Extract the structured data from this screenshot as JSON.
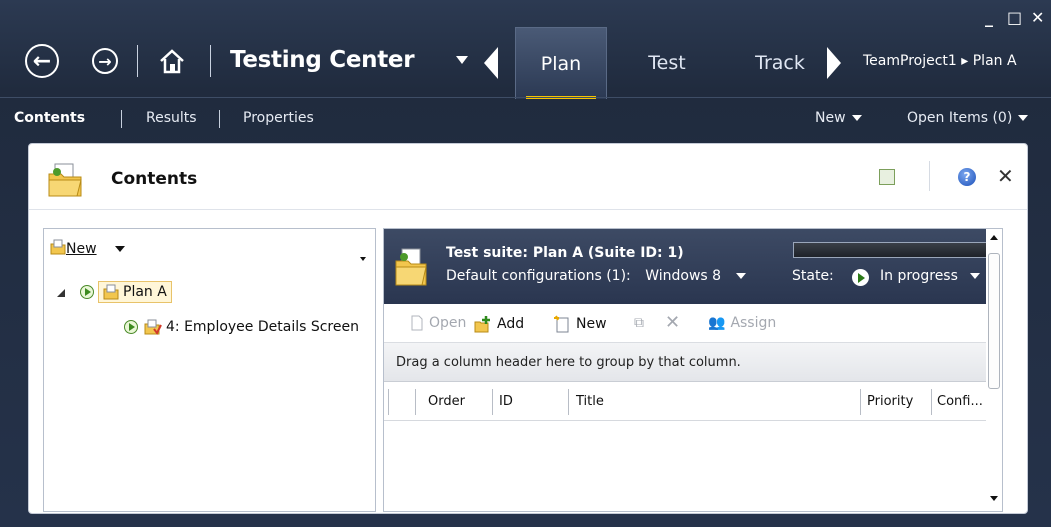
{
  "title_bar": {
    "app_title": "Testing Center",
    "tabs": [
      {
        "label": "Plan",
        "active": true
      },
      {
        "label": "Test",
        "active": false
      },
      {
        "label": "Track",
        "active": false
      }
    ],
    "breadcrumb": "TeamProject1 ▸ Plan A",
    "window_controls": {
      "minimize": "_",
      "maximize": "□",
      "close": "✕"
    }
  },
  "subnav": {
    "items": [
      {
        "label": "Contents",
        "active": true
      },
      {
        "label": "Results",
        "active": false
      },
      {
        "label": "Properties",
        "active": false
      }
    ],
    "new_label": "New",
    "open_items_label": "Open Items (0)"
  },
  "panel": {
    "title": "Contents",
    "icons": [
      "refresh-icon",
      "help-icon",
      "close-icon"
    ]
  },
  "tree": {
    "new_label": "New",
    "nodes": [
      {
        "label": "Plan A",
        "icon": "folder-icon",
        "selected": true
      },
      {
        "label": "4: Employee Details Screen",
        "icon": "requirement-suite-icon",
        "selected": false
      }
    ]
  },
  "suite": {
    "title": "Test suite:  Plan A (Suite ID: 1)",
    "config_label": "Default configurations (1):",
    "config_value": "Windows 8",
    "state_label": "State:",
    "state_value": "In progress"
  },
  "toolbar": {
    "open": "Open",
    "add": "Add",
    "new": "New",
    "assign": "Assign"
  },
  "group_hint": "Drag a column header here to group by that column.",
  "columns": [
    "Order",
    "ID",
    "Title",
    "Priority",
    "Confi..."
  ],
  "colors": {
    "accent_tab_underline": "#f5c400",
    "header_bg": "#202b3e"
  }
}
